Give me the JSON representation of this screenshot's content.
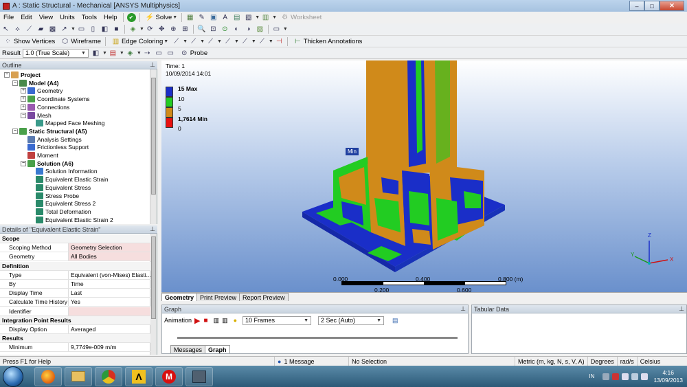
{
  "window": {
    "title": "A : Static Structural - Mechanical [ANSYS Multiphysics]",
    "min": "–",
    "max": "□",
    "close": "✕"
  },
  "menu": [
    "File",
    "Edit",
    "View",
    "Units",
    "Tools",
    "Help"
  ],
  "toolbar1": {
    "solve": "Solve",
    "worksheet": "Worksheet"
  },
  "toolbar2": {
    "show_vertices": "Show Vertices",
    "wireframe": "Wireframe",
    "edge_coloring": "Edge Coloring",
    "thicken": "Thicken Annotations"
  },
  "toolbar3": {
    "result_label": "Result",
    "scale": "1.0 (True Scale)",
    "probe": "Probe"
  },
  "outline": {
    "header": "Outline",
    "items": [
      {
        "label": "Project",
        "level": 0,
        "bold": true,
        "expand": "−",
        "color": "#d8a050"
      },
      {
        "label": "Model (A4)",
        "level": 1,
        "bold": true,
        "expand": "−",
        "color": "#4a8a4a"
      },
      {
        "label": "Geometry",
        "level": 2,
        "bold": false,
        "expand": "+",
        "color": "#3a6ad0"
      },
      {
        "label": "Coordinate Systems",
        "level": 2,
        "bold": false,
        "expand": "+",
        "color": "#4aa04a"
      },
      {
        "label": "Connections",
        "level": 2,
        "bold": false,
        "expand": "+",
        "color": "#9a5ab0"
      },
      {
        "label": "Mesh",
        "level": 2,
        "bold": false,
        "expand": "−",
        "color": "#7a4aa0"
      },
      {
        "label": "Mapped Face Meshing",
        "level": 3,
        "bold": false,
        "expand": "",
        "color": "#3a9a8a"
      },
      {
        "label": "Static Structural (A5)",
        "level": 1,
        "bold": true,
        "expand": "−",
        "color": "#4aa04a"
      },
      {
        "label": "Analysis Settings",
        "level": 2,
        "bold": false,
        "expand": "",
        "color": "#5a7ab0"
      },
      {
        "label": "Frictionless Support",
        "level": 2,
        "bold": false,
        "expand": "",
        "color": "#3a6ad0"
      },
      {
        "label": "Moment",
        "level": 2,
        "bold": false,
        "expand": "",
        "color": "#c04040"
      },
      {
        "label": "Solution (A6)",
        "level": 2,
        "bold": true,
        "expand": "−",
        "color": "#4aa04a"
      },
      {
        "label": "Solution Information",
        "level": 3,
        "bold": false,
        "expand": "",
        "color": "#3a7ad0"
      },
      {
        "label": "Equivalent Elastic Strain",
        "level": 3,
        "bold": false,
        "expand": "",
        "color": "#2a8a6a",
        "selected": true
      },
      {
        "label": "Equivalent Stress",
        "level": 3,
        "bold": false,
        "expand": "",
        "color": "#2a8a6a"
      },
      {
        "label": "Stress Probe",
        "level": 3,
        "bold": false,
        "expand": "",
        "color": "#2a8a6a"
      },
      {
        "label": "Equivalent Stress 2",
        "level": 3,
        "bold": false,
        "expand": "",
        "color": "#2a8a6a"
      },
      {
        "label": "Total Deformation",
        "level": 3,
        "bold": false,
        "expand": "",
        "color": "#2a8a6a"
      },
      {
        "label": "Equivalent Elastic Strain 2",
        "level": 3,
        "bold": false,
        "expand": "",
        "color": "#2a8a6a"
      }
    ]
  },
  "details": {
    "header": "Details of \"Equivalent Elastic Strain\"",
    "rows": [
      {
        "k": "Scope",
        "v": "",
        "type": "sect"
      },
      {
        "k": "Scoping Method",
        "v": "Geometry Selection",
        "type": "pink"
      },
      {
        "k": "Geometry",
        "v": "All Bodies",
        "type": "pink"
      },
      {
        "k": "Definition",
        "v": "",
        "type": "sect"
      },
      {
        "k": "Type",
        "v": "Equivalent (von-Mises) Elasti...",
        "type": ""
      },
      {
        "k": "By",
        "v": "Time",
        "type": ""
      },
      {
        "k": "Display Time",
        "v": "Last",
        "type": ""
      },
      {
        "k": "Calculate Time History",
        "v": "Yes",
        "type": ""
      },
      {
        "k": "Identifier",
        "v": "",
        "type": "pink"
      },
      {
        "k": "Integration Point Results",
        "v": "",
        "type": "sect"
      },
      {
        "k": "Display Option",
        "v": "Averaged",
        "type": ""
      },
      {
        "k": "Results",
        "v": "",
        "type": "sect"
      },
      {
        "k": "Minimum",
        "v": "9,7749e-009 m/m",
        "type": ""
      }
    ]
  },
  "viewport": {
    "time": "Time: 1",
    "date": "10/09/2014 14:01",
    "legend": [
      {
        "label": "15 Max",
        "color": "#1a2ec8",
        "bold": true
      },
      {
        "label": "10",
        "color": "#22cc22",
        "bold": false
      },
      {
        "label": "5",
        "color": "#d08a1a",
        "bold": false
      },
      {
        "label": "1,7614 Min",
        "color": "#e81010",
        "bold": true
      },
      {
        "label": "0",
        "color": "",
        "bold": false
      }
    ],
    "min_tag": "Min",
    "scale": {
      "t0": "0.000",
      "t1": "0.400",
      "t2": "0.800 (m)",
      "b1": "0.200",
      "b2": "0.600"
    },
    "axes": {
      "x": "X",
      "y": "Y",
      "z": "Z"
    }
  },
  "view_tabs": [
    "Geometry",
    "Print Preview",
    "Report Preview"
  ],
  "graph": {
    "header": "Graph",
    "animation": "Animation",
    "frames": "10 Frames",
    "duration": "2 Sec (Auto)",
    "tabs": [
      "Messages",
      "Graph"
    ]
  },
  "tabular": {
    "header": "Tabular Data"
  },
  "status": {
    "help": "Press F1 for Help",
    "messages": "1 Message",
    "selection": "No Selection",
    "units": "Metric (m, kg, N, s, V, A)",
    "angle": "Degrees",
    "rate": "rad/s",
    "temp": "Celsius"
  },
  "taskbar": {
    "lang": "IN",
    "time": "4:16",
    "date": "13/09/2013"
  },
  "colors": {
    "blue": "#1a2ec8",
    "green": "#22cc22",
    "orange": "#d08a1a",
    "red": "#e81010"
  }
}
